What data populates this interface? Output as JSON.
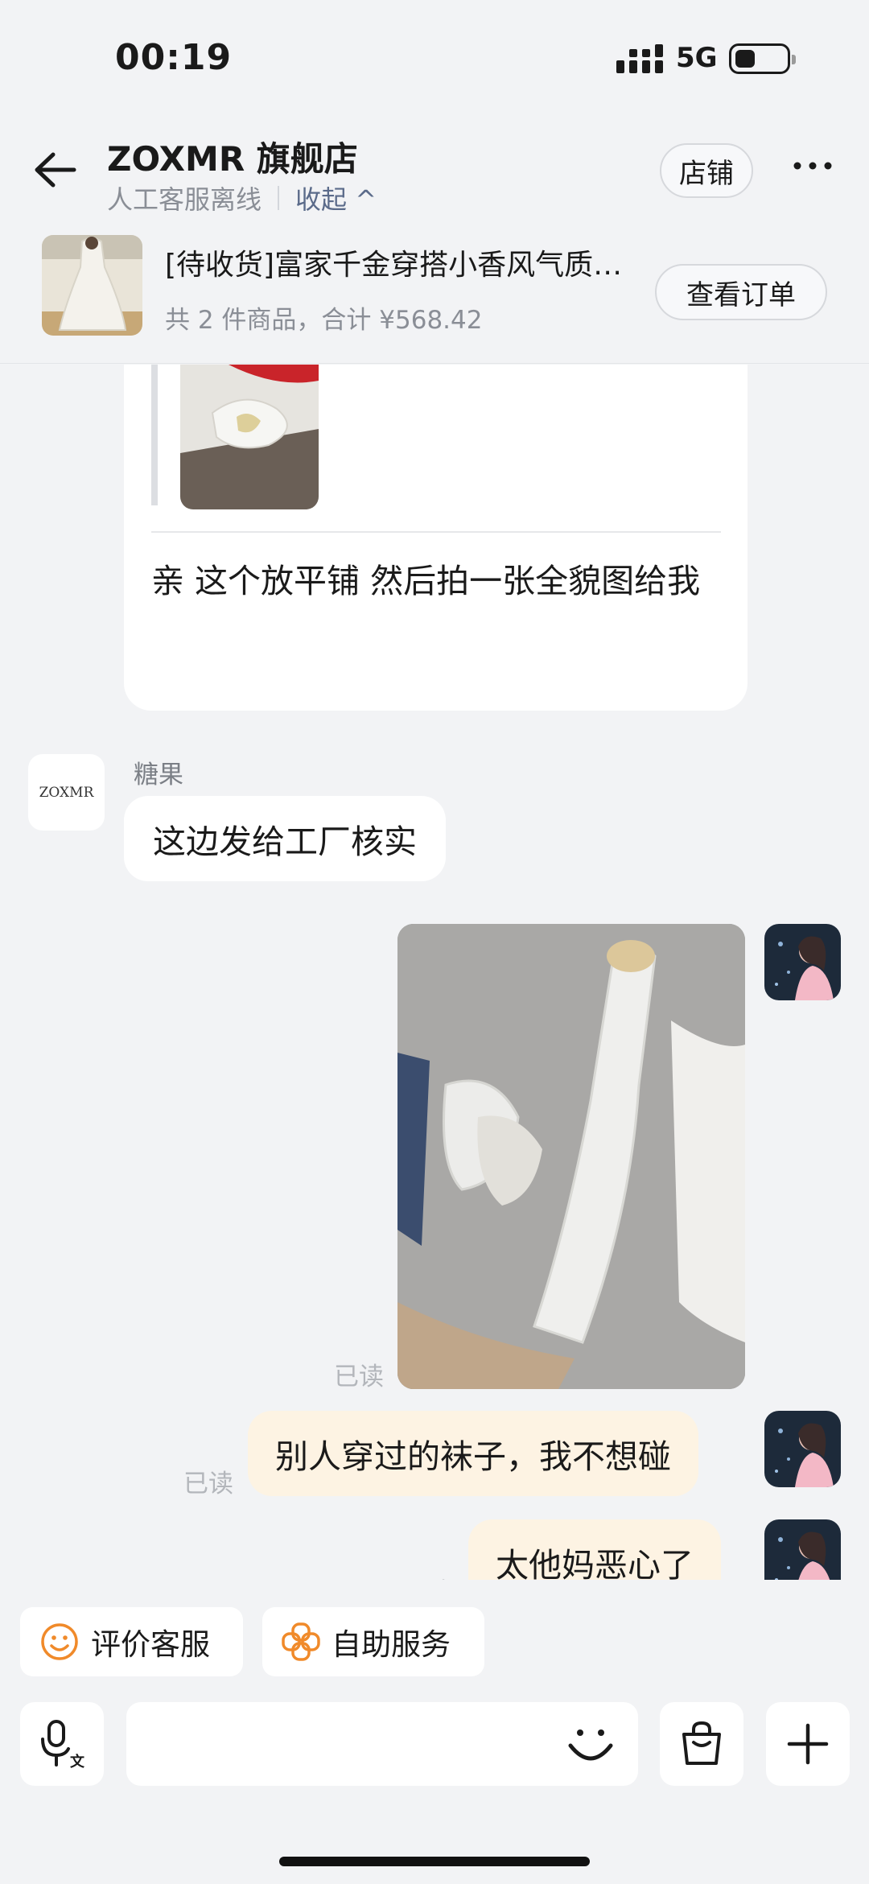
{
  "status_bar": {
    "time": "00:19",
    "network": "5G"
  },
  "header": {
    "shop_name": "ZOXMR 旗舰店",
    "service_status": "人工客服离线",
    "collapse_label": "收起 ^",
    "store_button": "店铺"
  },
  "order": {
    "title": "[待收货]富家千金穿搭小香风气质名媛连衣裙套装",
    "summary": "共 2 件商品，合计 ¥568.42",
    "view_button": "查看订单"
  },
  "messages": {
    "card_reply_text": "亲 这个放平铺 然后拍一张全貌图给我",
    "shop_avatar_text": "ZOXMR",
    "sender_name": "糖果",
    "shop_text": "这边发给工厂核实",
    "read_label": "已读",
    "user_text_1": "别人穿过的袜子，我不想碰",
    "user_text_2": "太他妈恶心了"
  },
  "quick_actions": {
    "rate_service": "评价客服",
    "self_service": "自助服务"
  },
  "input": {
    "placeholder": ""
  },
  "colors": {
    "accent_orange": "#f08a2a",
    "bubble_self": "#fdf3e3",
    "background": "#f2f3f5"
  }
}
